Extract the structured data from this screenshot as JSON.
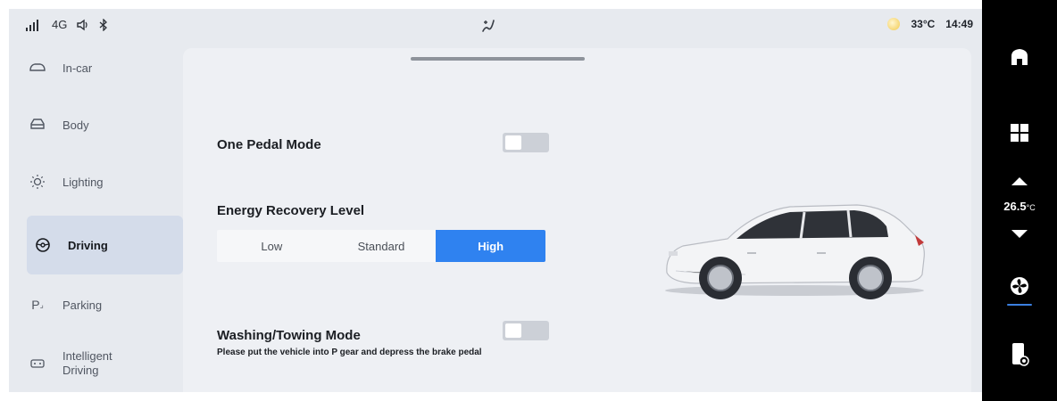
{
  "status_bar": {
    "signal": "4G",
    "time": "14:49",
    "temperature": "33°C"
  },
  "sidebar": {
    "items": [
      {
        "label": "In-car",
        "icon": "car-cabin-icon",
        "active": false
      },
      {
        "label": "Body",
        "icon": "car-body-icon",
        "active": false
      },
      {
        "label": "Lighting",
        "icon": "sun-icon",
        "active": false
      },
      {
        "label": "Driving",
        "icon": "steering-wheel-icon",
        "active": true
      },
      {
        "label": "Parking",
        "icon": "parking-icon",
        "active": false
      },
      {
        "label": "Intelligent Driving",
        "icon": "camera-icon",
        "active": false
      }
    ]
  },
  "main": {
    "one_pedal": {
      "label": "One Pedal Mode",
      "enabled": false
    },
    "energy_recovery": {
      "label": "Energy Recovery Level",
      "options": [
        "Low",
        "Standard",
        "High"
      ],
      "selected": "High"
    },
    "washing": {
      "label": "Washing/Towing Mode",
      "hint": "Please put the vehicle into P gear and depress the brake pedal",
      "enabled": false
    }
  },
  "rail": {
    "temperature_value": "26.5",
    "temperature_unit": "°C"
  },
  "colors": {
    "accent": "#2f82f0",
    "active_row": "#d4dcea",
    "panel": "#eef0f4",
    "background": "#e7eaef",
    "rail": "#000000"
  }
}
